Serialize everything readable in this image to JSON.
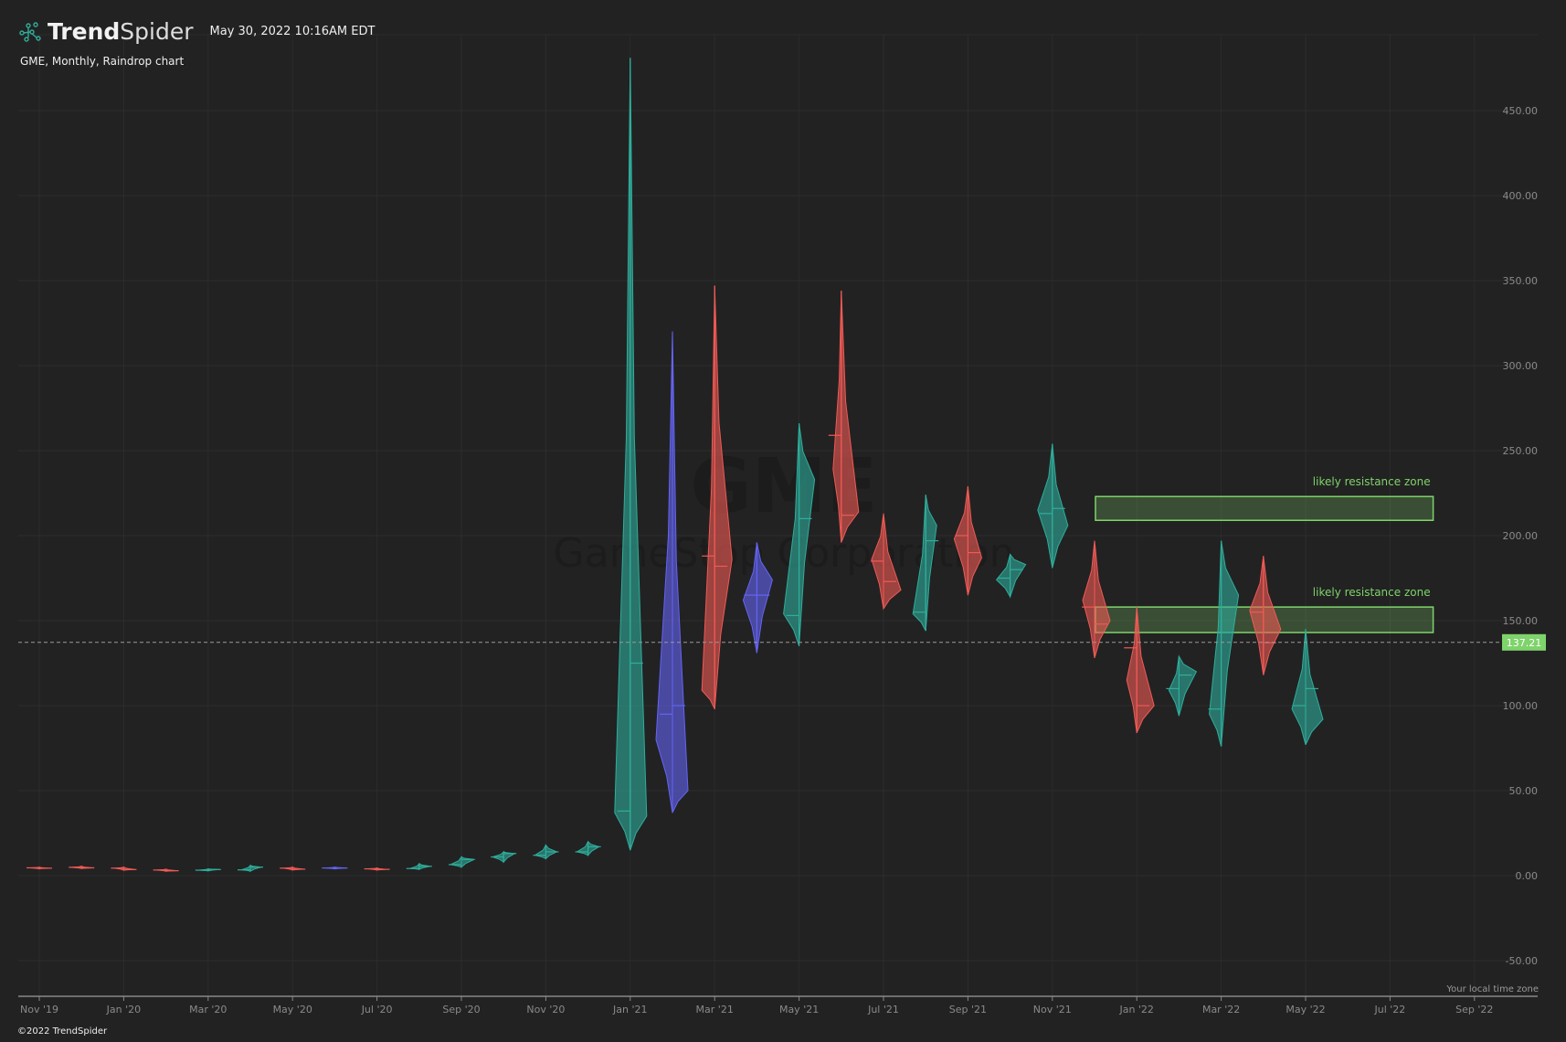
{
  "header": {
    "brand_bold": "Trend",
    "brand_light": "Spider",
    "timestamp": "May 30, 2022 10:16AM EDT",
    "subtitle": "GME, Monthly, Raindrop chart"
  },
  "footer": {
    "copyright": "©2022 TrendSpider",
    "timezone_note": "Your local time zone"
  },
  "watermark": {
    "symbol": "GME",
    "company": "GameStop Corporation"
  },
  "colors": {
    "background": "#222222",
    "up": "#2fae9c",
    "down": "#f05a55",
    "neutral": "#6464f5",
    "zone": "#7fd36b",
    "grid": "#2c2c2c"
  },
  "chart_data": {
    "type": "raindrop",
    "title": "GME, Monthly, Raindrop chart",
    "xlabel": "",
    "ylabel": "",
    "ylim": [
      -60,
      480
    ],
    "y_ticks": [
      "-50.00",
      "0.00",
      "50.00",
      "100.00",
      "150.00",
      "200.00",
      "250.00",
      "300.00",
      "350.00",
      "400.00",
      "450.00"
    ],
    "y_tick_values": [
      -50,
      0,
      50,
      100,
      150,
      200,
      250,
      300,
      350,
      400,
      450
    ],
    "x_ticks": [
      "Nov '19",
      "Jan '20",
      "Mar '20",
      "May '20",
      "Jul '20",
      "Sep '20",
      "Nov '20",
      "Jan '21",
      "Mar '21",
      "May '21",
      "Jul '21",
      "Sep '21",
      "Nov '21",
      "Jan '22",
      "Mar '22",
      "May '22",
      "Jul '22",
      "Sep '22"
    ],
    "x_tick_month_index": [
      0,
      2,
      4,
      6,
      8,
      10,
      12,
      14,
      16,
      18,
      20,
      22,
      24,
      26,
      28,
      30,
      32,
      34
    ],
    "grid": true,
    "last_price": "137.21",
    "last_price_value": 137.21,
    "drops": [
      {
        "month": "Nov '19",
        "dir": "down",
        "high": 5,
        "low": 4,
        "lp": 4.6,
        "lv": 0.5,
        "rp": 4.4,
        "rv": 0.5,
        "lvwap": 4.6,
        "rvwap": 4.4
      },
      {
        "month": "Dec '19",
        "dir": "down",
        "high": 5.5,
        "low": 4.2,
        "lp": 4.9,
        "lv": 0.6,
        "rp": 4.6,
        "rv": 0.6,
        "lvwap": 4.9,
        "rvwap": 4.6
      },
      {
        "month": "Jan '20",
        "dir": "down",
        "high": 5,
        "low": 3.2,
        "lp": 4.4,
        "lv": 0.5,
        "rp": 3.6,
        "rv": 0.6,
        "lvwap": 4.4,
        "rvwap": 3.6
      },
      {
        "month": "Feb '20",
        "dir": "down",
        "high": 3.8,
        "low": 2.6,
        "lp": 3.3,
        "lv": 0.5,
        "rp": 2.9,
        "rv": 0.6,
        "lvwap": 3.3,
        "rvwap": 2.9
      },
      {
        "month": "Mar '20",
        "dir": "up",
        "high": 4,
        "low": 2.8,
        "lp": 3.2,
        "lv": 0.5,
        "rp": 3.6,
        "rv": 0.6,
        "lvwap": 3.2,
        "rvwap": 3.6
      },
      {
        "month": "Apr '20",
        "dir": "up",
        "high": 6,
        "low": 2.6,
        "lp": 3.4,
        "lv": 0.5,
        "rp": 5,
        "rv": 0.6,
        "lvwap": 3.4,
        "rvwap": 5
      },
      {
        "month": "May '20",
        "dir": "down",
        "high": 5,
        "low": 3.3,
        "lp": 4.4,
        "lv": 0.5,
        "rp": 3.8,
        "rv": 0.6,
        "lvwap": 4.4,
        "rvwap": 3.8
      },
      {
        "month": "Jun '20",
        "dir": "neutral",
        "high": 5,
        "low": 4,
        "lp": 4.5,
        "lv": 0.5,
        "rp": 4.5,
        "rv": 0.6,
        "lvwap": 4.5,
        "rvwap": 4.5
      },
      {
        "month": "Jul '20",
        "dir": "down",
        "high": 4.5,
        "low": 3.3,
        "lp": 4,
        "lv": 0.5,
        "rp": 3.7,
        "rv": 0.5,
        "lvwap": 4,
        "rvwap": 3.7
      },
      {
        "month": "Aug '20",
        "dir": "up",
        "high": 7,
        "low": 3.7,
        "lp": 4.2,
        "lv": 0.5,
        "rp": 5.5,
        "rv": 0.6,
        "lvwap": 4.2,
        "rvwap": 5.5
      },
      {
        "month": "Sep '20",
        "dir": "up",
        "high": 11,
        "low": 5,
        "lp": 6.5,
        "lv": 0.6,
        "rp": 9.5,
        "rv": 0.7,
        "lvwap": 6.5,
        "rvwap": 9.5
      },
      {
        "month": "Oct '20",
        "dir": "up",
        "high": 14,
        "low": 8,
        "lp": 11,
        "lv": 0.6,
        "rp": 13,
        "rv": 0.6,
        "lvwap": 11,
        "rvwap": 13
      },
      {
        "month": "Nov '20",
        "dir": "up",
        "high": 18,
        "low": 10,
        "lp": 12,
        "lv": 0.6,
        "rp": 14,
        "rv": 0.6,
        "lvwap": 12,
        "rvwap": 14
      },
      {
        "month": "Dec '20",
        "dir": "up",
        "high": 20,
        "low": 12,
        "lp": 14,
        "lv": 0.6,
        "rp": 17,
        "rv": 0.6,
        "lvwap": 14,
        "rvwap": 17
      },
      {
        "month": "Jan '21",
        "dir": "up",
        "high": 481,
        "low": 15,
        "lp": 37,
        "lv": 0.85,
        "rp": 35,
        "rv": 0.9,
        "lvwap": 38,
        "rvwap": 125
      },
      {
        "month": "Feb '21",
        "dir": "neutral",
        "high": 320,
        "low": 37,
        "lp": 80,
        "lv": 0.9,
        "rp": 50,
        "rv": 0.85,
        "lvwap": 95,
        "rvwap": 100
      },
      {
        "month": "Mar '21",
        "dir": "down",
        "high": 347,
        "low": 98,
        "lp": 109,
        "lv": 0.7,
        "rp": 186,
        "rv": 0.95,
        "lvwap": 188,
        "rvwap": 182
      },
      {
        "month": "Apr '21",
        "dir": "neutral",
        "high": 196,
        "low": 131,
        "lp": 162,
        "lv": 0.75,
        "rp": 174,
        "rv": 0.85,
        "lvwap": 165,
        "rvwap": 165
      },
      {
        "month": "May '21",
        "dir": "up",
        "high": 266,
        "low": 135,
        "lp": 154,
        "lv": 0.85,
        "rp": 233,
        "rv": 0.85,
        "lvwap": 153,
        "rvwap": 210
      },
      {
        "month": "Jun '21",
        "dir": "down",
        "high": 344,
        "low": 196,
        "lp": 239,
        "lv": 0.45,
        "rp": 214,
        "rv": 0.95,
        "lvwap": 259,
        "rvwap": 212
      },
      {
        "month": "Jul '21",
        "dir": "down",
        "high": 213,
        "low": 157,
        "lp": 186,
        "lv": 0.65,
        "rp": 168,
        "rv": 0.95,
        "lvwap": 185,
        "rvwap": 173
      },
      {
        "month": "Aug '21",
        "dir": "up",
        "high": 224,
        "low": 144,
        "lp": 154,
        "lv": 0.7,
        "rp": 206,
        "rv": 0.6,
        "lvwap": 155,
        "rvwap": 197
      },
      {
        "month": "Sep '21",
        "dir": "down",
        "high": 229,
        "low": 165,
        "lp": 198,
        "lv": 0.75,
        "rp": 187,
        "rv": 0.75,
        "lvwap": 200,
        "rvwap": 190
      },
      {
        "month": "Oct '21",
        "dir": "up",
        "high": 189,
        "low": 164,
        "lp": 174,
        "lv": 0.75,
        "rp": 183,
        "rv": 0.85,
        "lvwap": 175,
        "rvwap": 180
      },
      {
        "month": "Nov '21",
        "dir": "up",
        "high": 254,
        "low": 181,
        "lp": 215,
        "lv": 0.8,
        "rp": 206,
        "rv": 0.85,
        "lvwap": 213,
        "rvwap": 216
      },
      {
        "month": "Dec '21",
        "dir": "down",
        "high": 197,
        "low": 128,
        "lp": 162,
        "lv": 0.65,
        "rp": 150,
        "rv": 0.85,
        "lvwap": 158,
        "rvwap": 148
      },
      {
        "month": "Jan '22",
        "dir": "down",
        "high": 158,
        "low": 84,
        "lp": 115,
        "lv": 0.55,
        "rp": 100,
        "rv": 0.95,
        "lvwap": 134,
        "rvwap": 100
      },
      {
        "month": "Feb '22",
        "dir": "up",
        "high": 129,
        "low": 94,
        "lp": 109,
        "lv": 0.55,
        "rp": 120,
        "rv": 0.95,
        "lvwap": 110,
        "rvwap": 118
      },
      {
        "month": "Mar '22",
        "dir": "up",
        "high": 197,
        "low": 76,
        "lp": 95,
        "lv": 0.65,
        "rp": 165,
        "rv": 0.95,
        "lvwap": 98,
        "rvwap": 143
      },
      {
        "month": "Apr '22",
        "dir": "down",
        "high": 188,
        "low": 118,
        "lp": 156,
        "lv": 0.75,
        "rp": 145,
        "rv": 0.95,
        "lvwap": 155,
        "rvwap": 137
      },
      {
        "month": "May '22",
        "dir": "up",
        "high": 145,
        "low": 77,
        "lp": 98,
        "lv": 0.75,
        "rp": 92,
        "rv": 0.95,
        "lvwap": 100,
        "rvwap": 110
      }
    ],
    "annotations": [
      {
        "label": "likely resistance zone",
        "price_low": 209,
        "price_high": 223,
        "start_month_index": 25,
        "end_month_index": 33
      },
      {
        "label": "likely resistance zone",
        "price_low": 143,
        "price_high": 158,
        "start_month_index": 25,
        "end_month_index": 33
      }
    ]
  }
}
